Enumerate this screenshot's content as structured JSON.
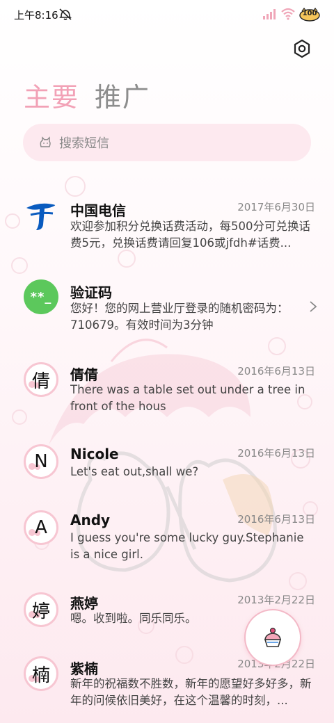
{
  "status_bar": {
    "time": "上午8:16",
    "battery": "100",
    "icons": [
      "mute-icon",
      "signal-icon",
      "wifi-icon",
      "battery-icon"
    ]
  },
  "header": {
    "settings_icon": "settings-hexagon-icon"
  },
  "tabs": [
    {
      "label": "主要",
      "active": true
    },
    {
      "label": "推广",
      "active": false
    }
  ],
  "search": {
    "placeholder": "搜索短信",
    "icon": "search-cat-icon"
  },
  "messages": [
    {
      "sender": "中国电信",
      "date": "2017年6月30日",
      "preview": "欢迎参加积分兑换话费活动，每500分可兑换话费5元，兑换话费请回复106或jfdh#话费...",
      "avatar_icon": "china-telecom-logo-icon"
    },
    {
      "sender": "验证码",
      "date": "",
      "preview": "您好！您的网上营业厅登录的随机密码为：710679。有效时间为3分钟",
      "avatar_icon": "verification-code-icon",
      "avatar_text": "**_"
    },
    {
      "sender": "倩倩",
      "date": "2016年6月13日",
      "preview": "There was a table set out under a tree in front of the hous",
      "avatar_letter": "倩"
    },
    {
      "sender": "Nicole",
      "date": "2016年6月13日",
      "preview": "Let's eat out,shall we?",
      "avatar_letter": "N"
    },
    {
      "sender": "Andy",
      "date": "2016年6月13日",
      "preview": "I guess you're some lucky guy.Stephanie is a nice girl.",
      "avatar_letter": "A"
    },
    {
      "sender": "燕婷",
      "date": "2013年2月22日",
      "preview": "嗯。收到啦。同乐同乐。",
      "avatar_letter": "婷"
    },
    {
      "sender": "紫楠",
      "date": "2013年2月22日",
      "preview": "新年的祝福数不胜数，新年的愿望好多好多，新年的问候依旧美好，在这个温馨的时刻，...",
      "avatar_letter": "楠"
    }
  ],
  "fab": {
    "icon": "compose-cake-icon"
  },
  "colors": {
    "accent_pink": "#f2a1b6",
    "search_bg": "#fde5ec",
    "telecom_blue": "#0a5bbf",
    "code_green": "#5cc85c"
  }
}
